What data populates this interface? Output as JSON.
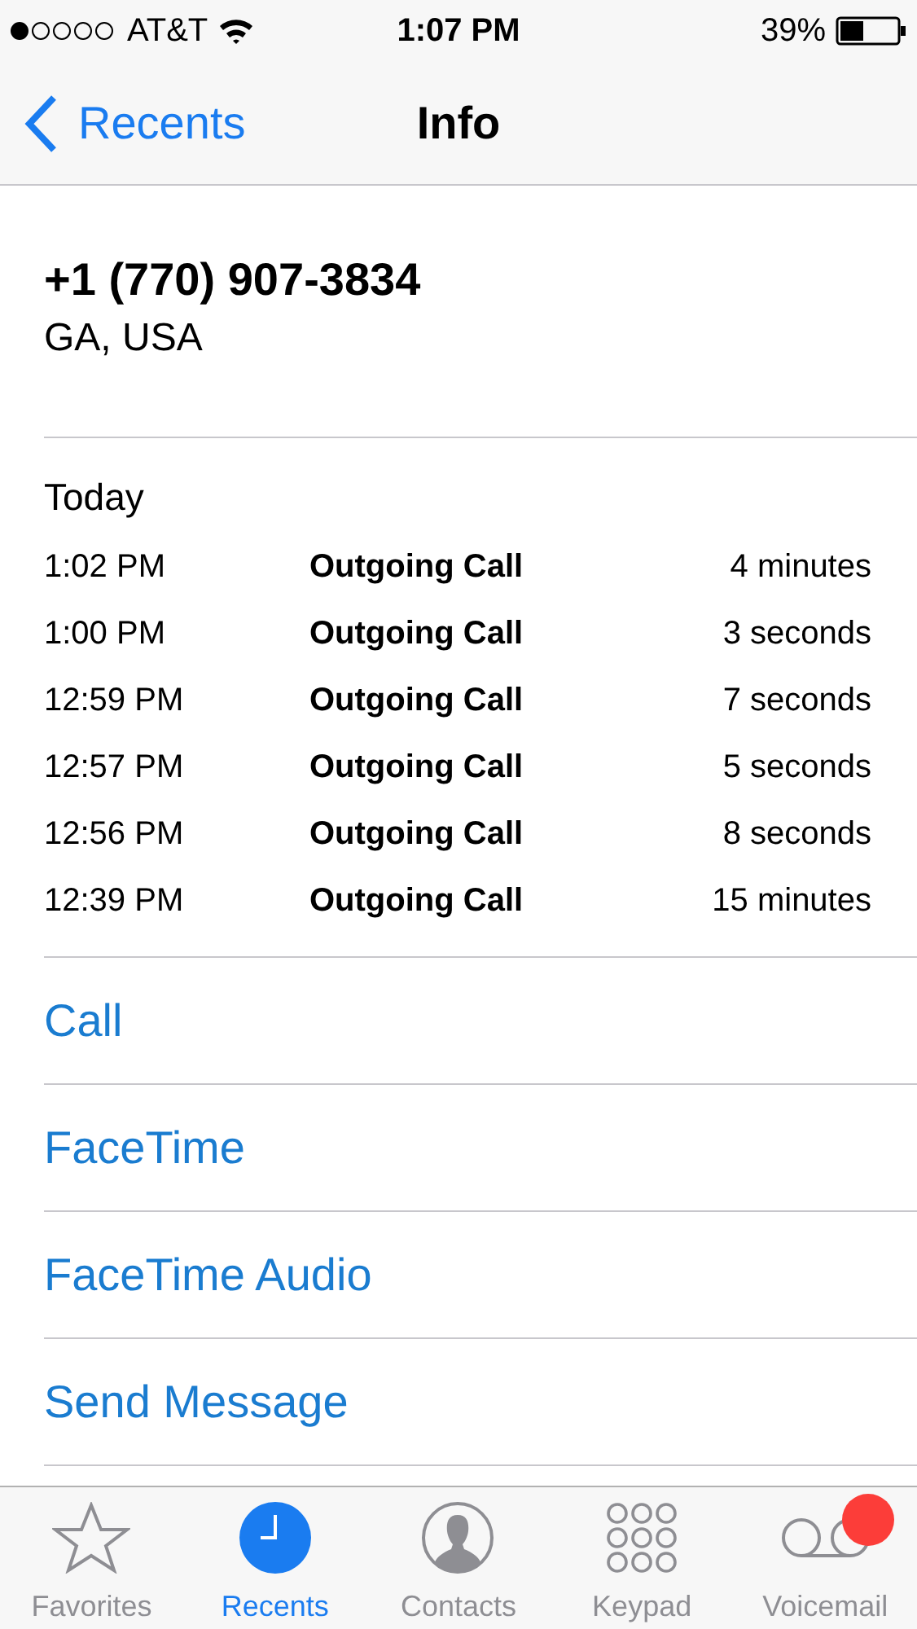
{
  "status_bar": {
    "carrier": "AT&T",
    "time": "1:07 PM",
    "battery": "39%"
  },
  "nav": {
    "back": "Recents",
    "title": "Info"
  },
  "contact": {
    "number": "+1 (770) 907-3834",
    "location": "GA, USA"
  },
  "history": {
    "heading": "Today",
    "calls": [
      {
        "time": "1:02 PM",
        "type": "Outgoing Call",
        "duration": "4 minutes"
      },
      {
        "time": "1:00 PM",
        "type": "Outgoing Call",
        "duration": "3 seconds"
      },
      {
        "time": "12:59 PM",
        "type": "Outgoing Call",
        "duration": "7 seconds"
      },
      {
        "time": "12:57 PM",
        "type": "Outgoing Call",
        "duration": "5 seconds"
      },
      {
        "time": "12:56 PM",
        "type": "Outgoing Call",
        "duration": "8 seconds"
      },
      {
        "time": "12:39 PM",
        "type": "Outgoing Call",
        "duration": "15 minutes"
      }
    ]
  },
  "actions": [
    "Call",
    "FaceTime",
    "FaceTime Audio",
    "Send Message"
  ],
  "tab_bar": [
    {
      "kind": "favorites",
      "label": "Favorites",
      "selected": false,
      "badge": false
    },
    {
      "kind": "recents",
      "label": "Recents",
      "selected": true,
      "badge": false
    },
    {
      "kind": "contacts",
      "label": "Contacts",
      "selected": false,
      "badge": false
    },
    {
      "kind": "keypad",
      "label": "Keypad",
      "selected": false,
      "badge": false
    },
    {
      "kind": "voicemail",
      "label": "Voicemail",
      "selected": false,
      "badge": true
    }
  ]
}
